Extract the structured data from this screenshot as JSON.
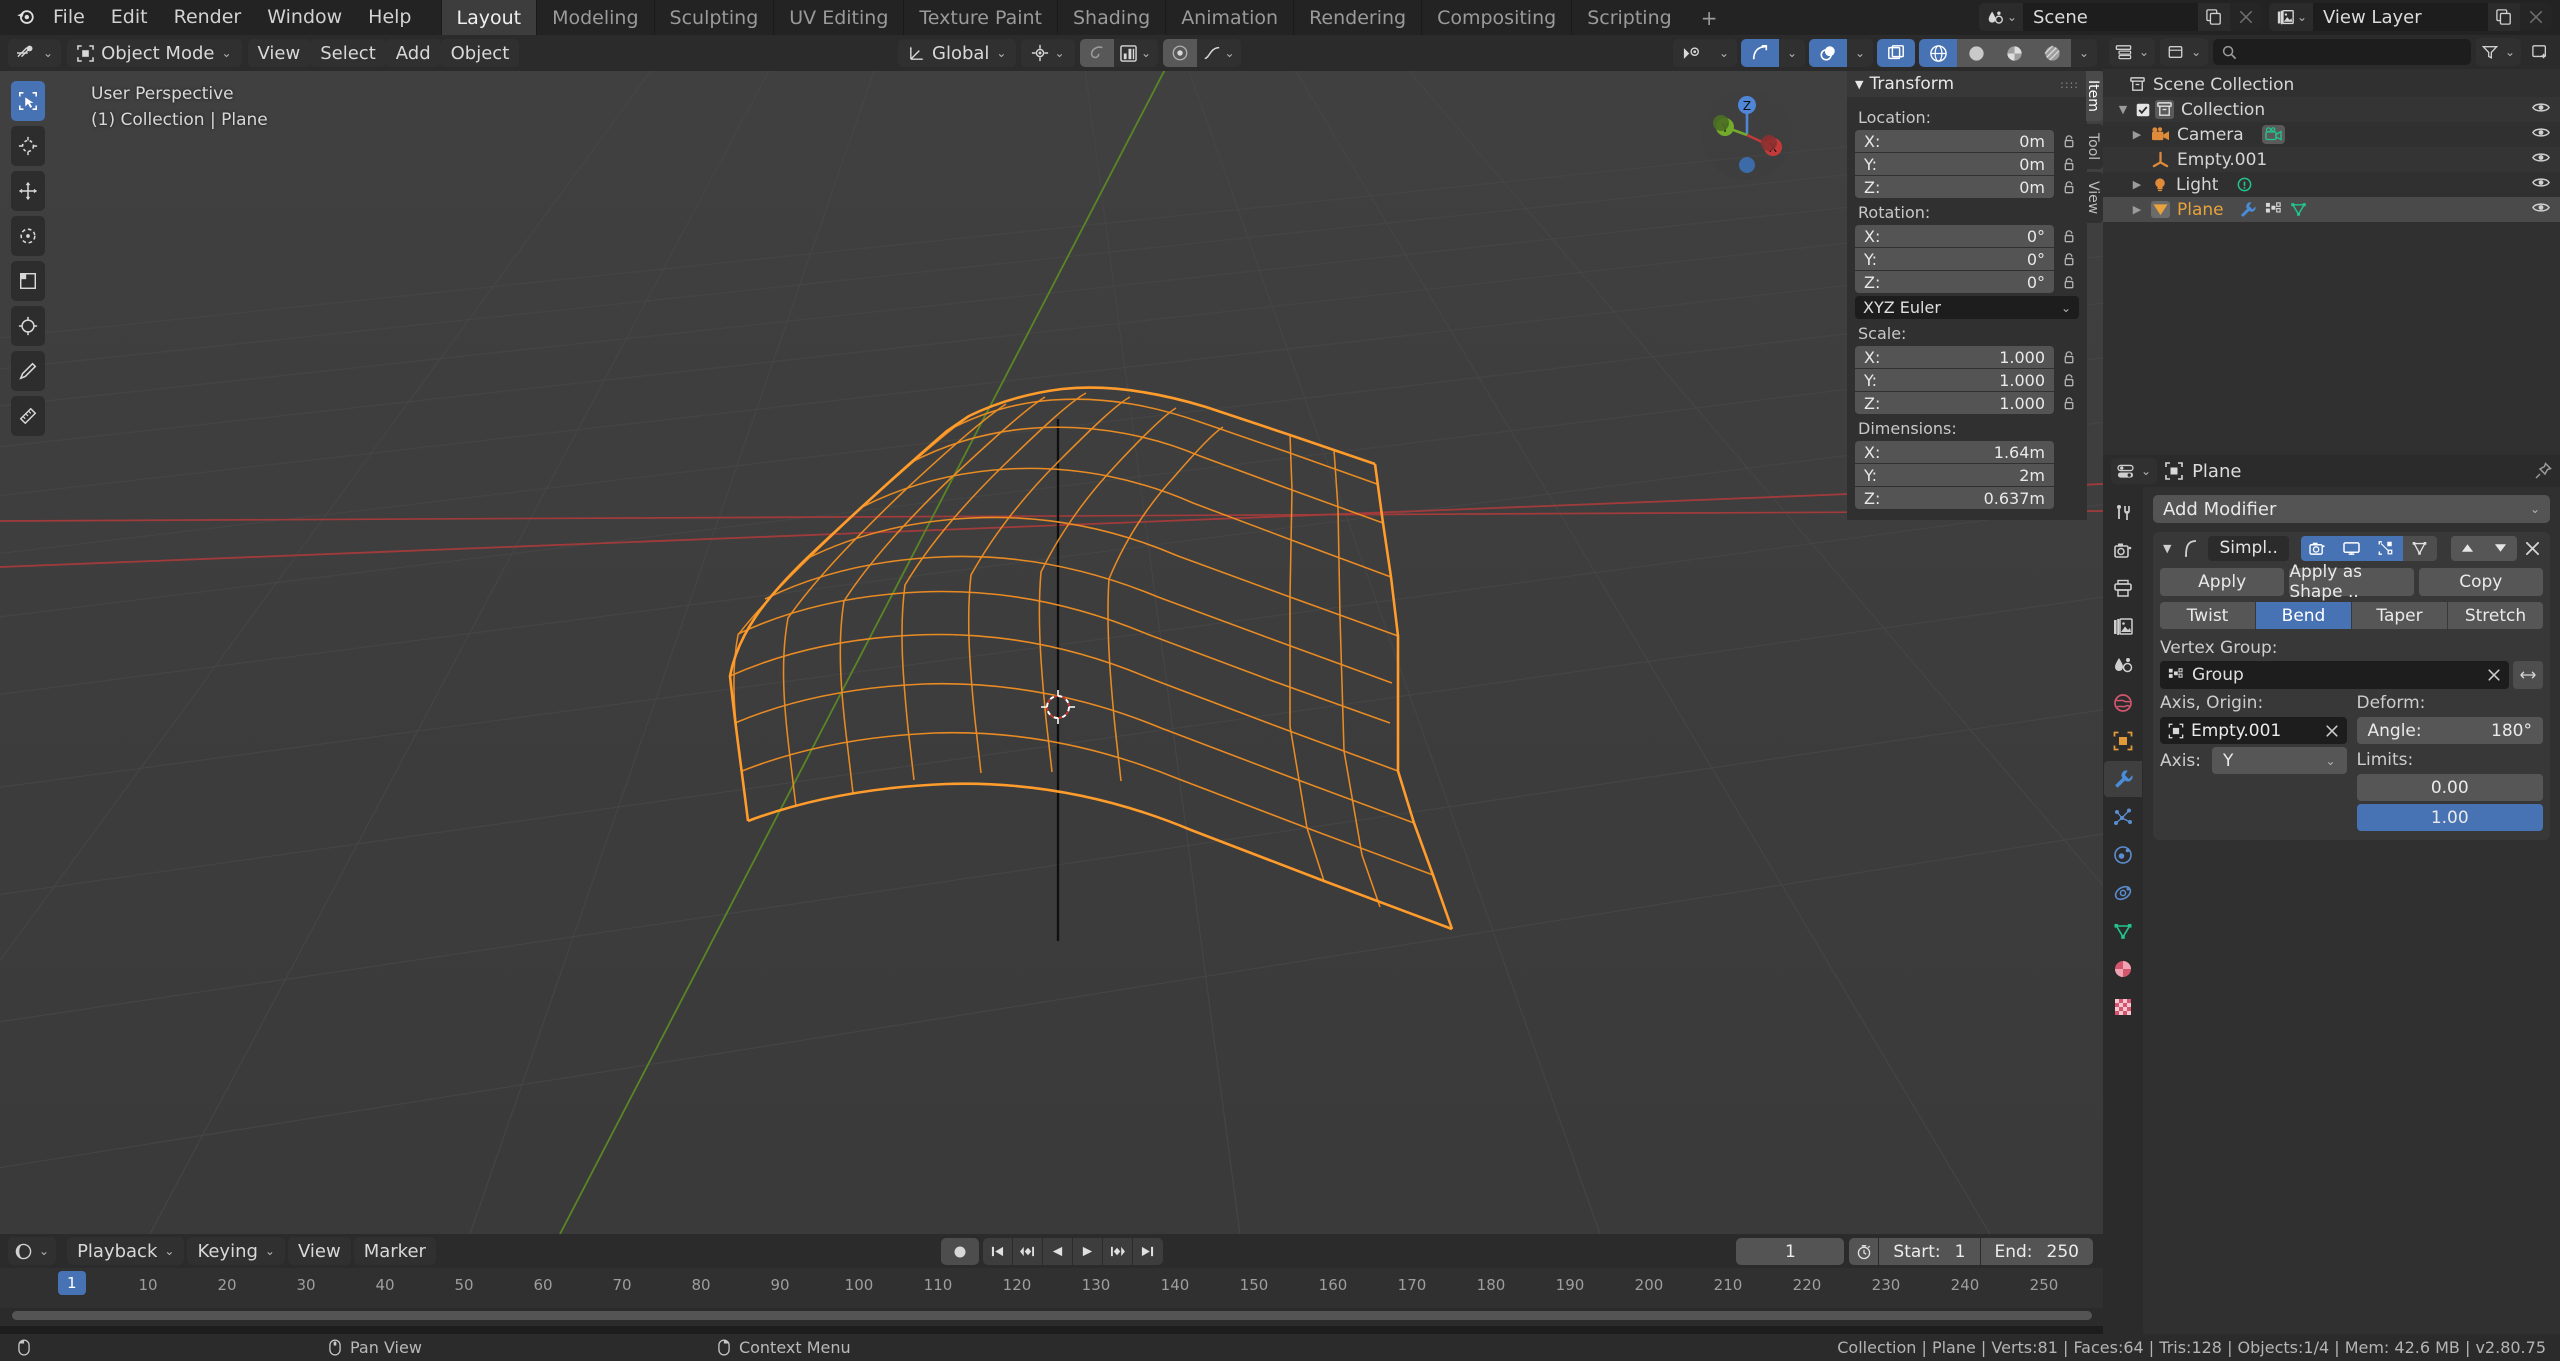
{
  "topbar": {
    "menus": [
      "File",
      "Edit",
      "Render",
      "Window",
      "Help"
    ],
    "workspaces": [
      {
        "label": "Layout",
        "active": true
      },
      {
        "label": "Modeling",
        "active": false
      },
      {
        "label": "Sculpting",
        "active": false
      },
      {
        "label": "UV Editing",
        "active": false
      },
      {
        "label": "Texture Paint",
        "active": false
      },
      {
        "label": "Shading",
        "active": false
      },
      {
        "label": "Animation",
        "active": false
      },
      {
        "label": "Rendering",
        "active": false
      },
      {
        "label": "Compositing",
        "active": false
      },
      {
        "label": "Scripting",
        "active": false
      }
    ],
    "add_workspace": "+",
    "scene_name": "Scene",
    "view_layer_name": "View Layer"
  },
  "viewport_header": {
    "mode": "Object Mode",
    "menus": [
      "View",
      "Select",
      "Add",
      "Object"
    ],
    "transform_orientation": "Global",
    "snap_icon": "magnet-icon",
    "proportional_icon": "proportional-edit-icon",
    "falloff_icon": "falloff-curve-icon"
  },
  "viewport": {
    "perspective_label": "User Perspective",
    "collection_label": "(1) Collection | Plane",
    "gizmo_axes": [
      "Z",
      "Y",
      "X"
    ]
  },
  "npanel": {
    "tab_labels": [
      "Item",
      "Tool",
      "View"
    ],
    "active_tab": "Item",
    "panel_title": "Transform",
    "location": {
      "label": "Location:",
      "x": "0m",
      "y": "0m",
      "z": "0m"
    },
    "rotation": {
      "label": "Rotation:",
      "x": "0°",
      "y": "0°",
      "z": "0°"
    },
    "rotation_mode": "XYZ Euler",
    "scale": {
      "label": "Scale:",
      "x": "1.000",
      "y": "1.000",
      "z": "1.000"
    },
    "dimensions": {
      "label": "Dimensions:",
      "x": "1.64m",
      "y": "2m",
      "z": "0.637m"
    },
    "axis_labels": [
      "X:",
      "Y:",
      "Z:"
    ]
  },
  "outliner": {
    "search_placeholder": "",
    "root": "Scene Collection",
    "items": [
      {
        "label": "Collection",
        "indent": 1,
        "icon": "collection-icon",
        "checkbox": true,
        "disclosure": "down",
        "selected": false,
        "color": "#d6d6d6",
        "extra": []
      },
      {
        "label": "Camera",
        "indent": 2,
        "icon": "camera-icon",
        "checkbox": false,
        "disclosure": "right",
        "selected": false,
        "color": "#d6d6d6",
        "extra": [
          "camera-data-icon"
        ]
      },
      {
        "label": "Empty.001",
        "indent": 2,
        "icon": "empty-axes-icon",
        "checkbox": false,
        "disclosure": "none",
        "selected": false,
        "color": "#d6d6d6",
        "extra": []
      },
      {
        "label": "Light",
        "indent": 2,
        "icon": "light-icon",
        "checkbox": false,
        "disclosure": "right",
        "selected": false,
        "color": "#d6d6d6",
        "extra": [
          "light-data-icon"
        ]
      },
      {
        "label": "Plane",
        "indent": 2,
        "icon": "mesh-icon",
        "checkbox": false,
        "disclosure": "right",
        "selected": true,
        "color": "#e8a33d",
        "extra": [
          "modifier-wrench-icon",
          "vertex-group-icon",
          "mesh-data-icon"
        ]
      }
    ]
  },
  "properties": {
    "breadcrumb_object": "Plane",
    "add_modifier": "Add Modifier",
    "tabs": [
      {
        "name": "tool-tab",
        "active": false
      },
      {
        "name": "render-tab",
        "active": false
      },
      {
        "name": "output-tab",
        "active": false
      },
      {
        "name": "view-layer-tab",
        "active": false
      },
      {
        "name": "scene-tab",
        "active": false
      },
      {
        "name": "world-tab",
        "active": false
      },
      {
        "name": "object-tab",
        "active": false
      },
      {
        "name": "modifier-tab",
        "active": true
      },
      {
        "name": "particles-tab",
        "active": false
      },
      {
        "name": "physics-tab",
        "active": false
      },
      {
        "name": "constraints-tab",
        "active": false
      },
      {
        "name": "data-tab",
        "active": false
      },
      {
        "name": "material-tab",
        "active": false
      },
      {
        "name": "texture-tab",
        "active": false
      }
    ],
    "modifier": {
      "name": "Simpl..",
      "display_toggles": [
        "render-toggle",
        "realtime-toggle",
        "edit-mode-toggle",
        "on-cage-toggle"
      ],
      "buttons": [
        "Apply",
        "Apply as Shape ..",
        "Copy"
      ],
      "deform_modes": [
        {
          "label": "Twist",
          "active": false
        },
        {
          "label": "Bend",
          "active": true
        },
        {
          "label": "Taper",
          "active": false
        },
        {
          "label": "Stretch",
          "active": false
        }
      ],
      "vertex_group_label": "Vertex Group:",
      "vertex_group_value": "Group",
      "axis_origin_label": "Axis, Origin:",
      "origin_object": "Empty.001",
      "axis_label": "Axis:",
      "axis_value": "Y",
      "deform_label": "Deform:",
      "angle_label": "Angle:",
      "angle_value": "180°",
      "limits_label": "Limits:",
      "limit_lower": "0.00",
      "limit_upper": "1.00"
    }
  },
  "timeline": {
    "menus": [
      "Playback",
      "Keying",
      "View",
      "Marker"
    ],
    "current_frame": "1",
    "start_label": "Start:",
    "start_value": "1",
    "end_label": "End:",
    "end_value": "250",
    "playhead_frame": "1",
    "ticks": [
      "10",
      "20",
      "30",
      "40",
      "50",
      "60",
      "70",
      "80",
      "90",
      "100",
      "110",
      "120",
      "130",
      "140",
      "150",
      "160",
      "170",
      "180",
      "190",
      "200",
      "210",
      "220",
      "230",
      "240",
      "250"
    ]
  },
  "statusbar": {
    "mouse_hints": [
      {
        "icon": "mouse-left-icon",
        "label": ""
      },
      {
        "icon": "mouse-middle-icon",
        "label": "Pan View"
      },
      {
        "icon": "mouse-right-icon",
        "label": "Context Menu"
      }
    ],
    "stats": "Collection | Plane | Verts:81 | Faces:64 | Tris:128 | Objects:1/4 | Mem: 42.6 MB | v2.80.75"
  },
  "colors": {
    "accent_blue": "#4772b3",
    "selected_orange": "#e8a33d",
    "bg_dark": "#1d1d1d",
    "bg_panel": "#303030",
    "bg_header": "#2b2b2b",
    "viewport_bg": "#3b3b3b",
    "axis_x_red": "#c44a4a",
    "axis_y_green": "#6b9c2f"
  }
}
